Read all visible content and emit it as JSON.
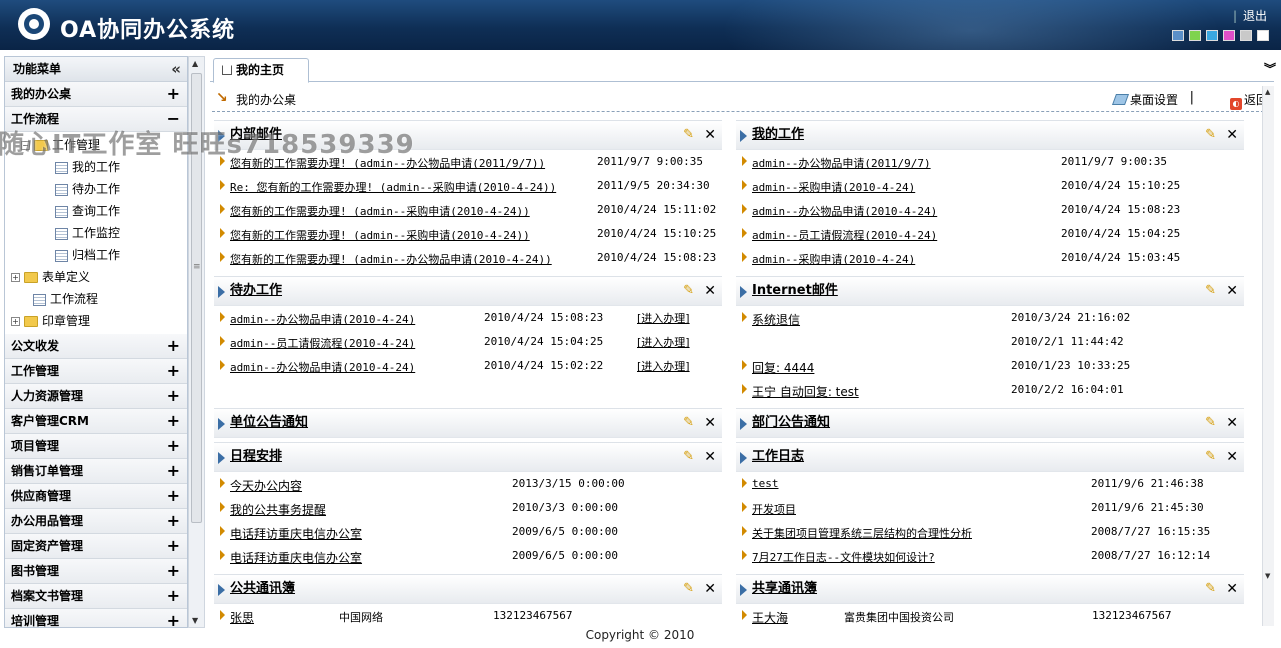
{
  "header": {
    "title": "OA协同办公系统",
    "logout": "退出",
    "skin_colors": [
      "#5b8fc8",
      "#7fd34e",
      "#3aa7e0",
      "#e04fc8",
      "#c9c9c9",
      "#ffffff"
    ]
  },
  "watermark": "随心IT工作室 旺旺s718539339",
  "sidebar": {
    "title": "功能菜单",
    "sections_top": [
      {
        "label": "我的办公桌",
        "sign": "+"
      },
      {
        "label": "工作流程",
        "sign": "−"
      }
    ],
    "workflow_tree": {
      "group": "工作管理",
      "children": [
        "我的工作",
        "待办工作",
        "查询工作",
        "工作监控",
        "归档工作"
      ],
      "form_def": "表单定义",
      "workflow": "工作流程",
      "seal_mgmt": "印章管理"
    },
    "sections": [
      {
        "label": "公文收发",
        "sign": "+"
      },
      {
        "label": "工作管理",
        "sign": "+"
      },
      {
        "label": "人力资源管理",
        "sign": "+"
      },
      {
        "label": "客户管理CRM",
        "sign": "+"
      },
      {
        "label": "项目管理",
        "sign": "+"
      },
      {
        "label": "销售订单管理",
        "sign": "+"
      },
      {
        "label": "供应商管理",
        "sign": "+"
      },
      {
        "label": "办公用品管理",
        "sign": "+"
      },
      {
        "label": "固定资产管理",
        "sign": "+"
      },
      {
        "label": "图书管理",
        "sign": "+"
      },
      {
        "label": "档案文书管理",
        "sign": "+"
      },
      {
        "label": "培训管理",
        "sign": "+"
      }
    ]
  },
  "tabs": {
    "home": "我的主页"
  },
  "desk": {
    "title": "我的办公桌",
    "settings": "桌面设置",
    "sep": "|",
    "back": "返回"
  },
  "portlets": {
    "internal_mail": {
      "title": "内部邮件",
      "rows": [
        {
          "text": "您有新的工作需要办理! (admin--办公物品申请(2011/9/7))",
          "date": "2011/9/7 9:00:35"
        },
        {
          "text": "Re: 您有新的工作需要办理! (admin--采购申请(2010-4-24))",
          "date": "2011/9/5 20:34:30"
        },
        {
          "text": "您有新的工作需要办理! (admin--采购申请(2010-4-24))",
          "date": "2010/4/24 15:11:02"
        },
        {
          "text": "您有新的工作需要办理! (admin--采购申请(2010-4-24))",
          "date": "2010/4/24 15:10:25"
        },
        {
          "text": "您有新的工作需要办理! (admin--办公物品申请(2010-4-24))",
          "date": "2010/4/24 15:08:23"
        }
      ]
    },
    "my_work": {
      "title": "我的工作",
      "rows": [
        {
          "text": "admin--办公物品申请(2011/9/7)",
          "date": "2011/9/7 9:00:35"
        },
        {
          "text": "admin--采购申请(2010-4-24)",
          "date": "2010/4/24 15:10:25"
        },
        {
          "text": "admin--办公物品申请(2010-4-24)",
          "date": "2010/4/24 15:08:23"
        },
        {
          "text": "admin--员工请假流程(2010-4-24)",
          "date": "2010/4/24 15:04:25"
        },
        {
          "text": "admin--采购申请(2010-4-24)",
          "date": "2010/4/24 15:03:45"
        }
      ]
    },
    "todo": {
      "title": "待办工作",
      "rows": [
        {
          "text": "admin--办公物品申请(2010-4-24)",
          "date": "2010/4/24 15:08:23",
          "action": "[进入办理]"
        },
        {
          "text": "admin--员工请假流程(2010-4-24)",
          "date": "2010/4/24 15:04:25",
          "action": "[进入办理]"
        },
        {
          "text": "admin--办公物品申请(2010-4-24)",
          "date": "2010/4/24 15:02:22",
          "action": "[进入办理]"
        }
      ]
    },
    "internet_mail": {
      "title": "Internet邮件",
      "rows": [
        {
          "text": "系统退信",
          "date": "2010/3/24 21:16:02"
        },
        {
          "text": "",
          "date": "2010/2/1 11:44:42"
        },
        {
          "text": "回复: 4444",
          "date": "2010/1/23 10:33:25"
        },
        {
          "text": "王宁 自动回复: test",
          "date": "2010/2/2 16:04:01"
        }
      ]
    },
    "unit_notice": {
      "title": "单位公告通知"
    },
    "dept_notice": {
      "title": "部门公告通知"
    },
    "schedule": {
      "title": "日程安排",
      "rows": [
        {
          "text": "今天办公内容",
          "date": "2013/3/15 0:00:00"
        },
        {
          "text": "我的公共事务提醒",
          "date": "2010/3/3 0:00:00"
        },
        {
          "text": "电话拜访重庆电信办公室",
          "date": "2009/6/5 0:00:00"
        },
        {
          "text": "电话拜访重庆电信办公室",
          "date": "2009/6/5 0:00:00"
        }
      ]
    },
    "work_log": {
      "title": "工作日志",
      "rows": [
        {
          "text": "test",
          "date": "2011/9/6 21:46:38"
        },
        {
          "text": "开发项目",
          "date": "2011/9/6 21:45:30"
        },
        {
          "text": "关于集团项目管理系统三层结构的合理性分析",
          "date": "2008/7/27 16:15:35"
        },
        {
          "text": "7月27工作日志--文件模块如何设计?",
          "date": "2008/7/27 16:12:14"
        }
      ]
    },
    "public_contacts": {
      "title": "公共通讯簿",
      "rows": [
        {
          "name": "张思",
          "company": "中国网络",
          "phone": "132123467567"
        }
      ]
    },
    "shared_contacts": {
      "title": "共享通讯簿",
      "rows": [
        {
          "name": "王大海",
          "company": "富贵集团中国投资公司",
          "phone": "132123467567"
        }
      ]
    }
  },
  "footer": "Copyright © 2010"
}
